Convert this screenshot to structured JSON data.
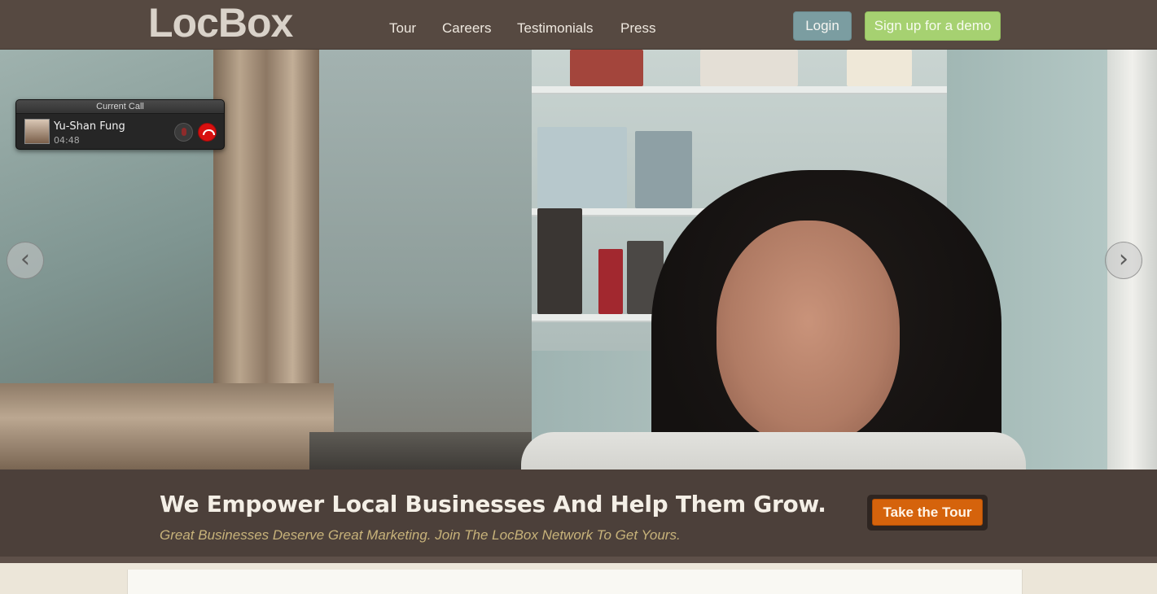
{
  "header": {
    "logo_text": "LocBox",
    "nav": [
      {
        "label": "Tour"
      },
      {
        "label": "Careers"
      },
      {
        "label": "Testimonials"
      },
      {
        "label": "Press"
      }
    ],
    "login_label": "Login",
    "demo_label": "Sign up for a demo"
  },
  "hero": {
    "call_widget": {
      "title": "Current Call",
      "caller_name": "Yu-Shan Fung",
      "duration": "04:48"
    },
    "prev_arrow": "‹",
    "next_arrow": "›"
  },
  "banner": {
    "headline": "We Empower Local Businesses And Help Them Grow.",
    "tagline": "Great Businesses Deserve Great Marketing. Join The LocBox Network To Get Yours.",
    "tour_button": "Take the Tour"
  },
  "colors": {
    "topbar": "#564941",
    "banner": "#4c403a",
    "login": "#7b9da1",
    "demo": "#a6d171",
    "tour": "#d5630c",
    "tagline": "#c7b27a"
  }
}
